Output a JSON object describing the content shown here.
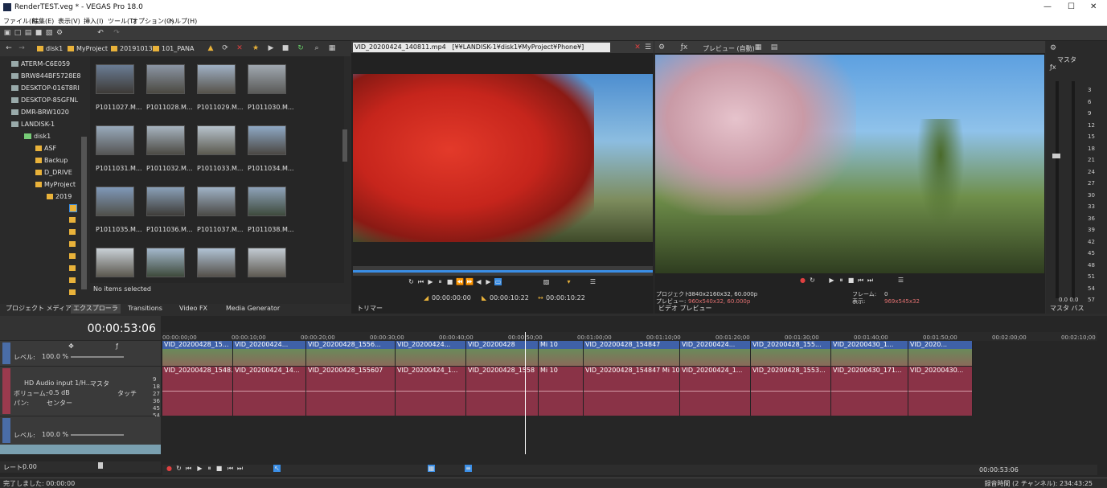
{
  "app": {
    "title": "RenderTEST.veg * - VEGAS Pro 18.0"
  },
  "menu": [
    "ファイル(F)",
    "編集(E)",
    "表示(V)",
    "挿入(I)",
    "ツール(T)",
    "オプション(O)",
    "ヘルプ(H)"
  ],
  "explorer": {
    "breadcrumb": [
      "disk1",
      "MyProject",
      "20191013",
      "101_PANA"
    ],
    "tree": [
      "ATERM-C6E059",
      "BRW844BF5728E8",
      "DESKTOP-016T8RI",
      "DESKTOP-85GFNL",
      "DMR-BRW1020",
      "LANDISK-1",
      "disk1",
      "ASF",
      "Backup",
      "D_DRIVE",
      "MyProject",
      "2019"
    ],
    "files": [
      "P1011027.M...",
      "P1011028.M...",
      "P1011029.M...",
      "P1011030.M...",
      "P1011031.M...",
      "P1011032.M...",
      "P1011033.M...",
      "P1011034.M...",
      "P1011035.M...",
      "P1011036.M...",
      "P1011037.M...",
      "P1011038.M..."
    ],
    "status": "No items selected"
  },
  "left_tabs": [
    "プロジェクト メディア",
    "エクスプローラ",
    "Transitions",
    "Video FX",
    "Media Generator"
  ],
  "trimmer": {
    "file": "VID_20200424_140811.mp4",
    "path": "[¥¥LANDISK-1¥disk1¥MyProject¥Phone¥]",
    "tab": "トリマー",
    "time_in": "00:00:00:00",
    "time_out": "00:00:10:22",
    "time_len": "00:00:10:22"
  },
  "preview": {
    "mode": "プレビュー (自動)",
    "tab": "ビデオ プレビュー",
    "project_label": "プロジェクト:",
    "project_value": "3840x2160x32, 60.000p",
    "preview_label": "プレビュー:",
    "preview_value": "960x540x32, 60.000p",
    "frame_label": "フレーム:",
    "frame_value": "0",
    "display_label": "表示:",
    "display_value": "969x545x32"
  },
  "master": {
    "label": "マスタ",
    "tab": "マスタ バス",
    "scale": [
      "3",
      "6",
      "9",
      "12",
      "15",
      "18",
      "21",
      "24",
      "27",
      "30",
      "33",
      "36",
      "39",
      "42",
      "45",
      "48",
      "51",
      "54",
      "57"
    ],
    "bottom": "0.0  0.0"
  },
  "timeline": {
    "timecode": "00:00:53:06",
    "ruler": [
      "00:00:00;00",
      "00:00:10;00",
      "00:00:20;00",
      "00:00:30;00",
      "00:00:40;00",
      "00:00:50;00",
      "00:01:00;00",
      "00:01:10;00",
      "00:01:20;00",
      "00:01:30;00",
      "00:01:40;00",
      "00:01:50;00",
      "00:02:00;00",
      "00:02:10;00"
    ],
    "track1_level": "レベル:",
    "track1_value": "100.0 %",
    "audio_name": "HD Audio input 1/H...",
    "audio_master": "マスタ",
    "volume_label": "ボリューム:",
    "volume_value": "-0.5 dB",
    "touch": "タッチ",
    "pan_label": "パン:",
    "pan_value": "センター",
    "db_scale": [
      "9",
      "18",
      "27",
      "36",
      "45",
      "54"
    ],
    "track3_level": "レベル:",
    "track3_value": "100.0 %",
    "video_clips": [
      "VID_20200428_15...",
      "VID_20200424...",
      "VID_20200428_1556...",
      "VID_20200424...",
      "VID_20200428",
      "Mi 10",
      "",
      "VID_20200428_154847",
      "VID_20200424...",
      "VID_20200428_155...",
      "VID_20200430_1...",
      "VID_2020..."
    ],
    "audio_clips": [
      "VID_20200428_1548...",
      "VID_20200424_14...",
      "VID_20200428_155607",
      "VID_20200424_1...",
      "VID_20200428_1558",
      "Mi 10",
      "",
      "VID_20200428_154847 Mi 10",
      "VID_20200424_1...",
      "VID_20200428_1553...",
      "VID_20200430_171...",
      "VID_20200430..."
    ],
    "rate_label": "レート:",
    "rate_value": "0.00",
    "end_time": "00:00:53:06"
  },
  "status": {
    "left": "完了しました: 00:00:00",
    "right": "録音時間 (2 チャンネル): 234:43:25"
  },
  "colors": {
    "accent": "#3a8ee6",
    "video_clip": "#3f61a8",
    "audio_clip": "#8a3347"
  }
}
